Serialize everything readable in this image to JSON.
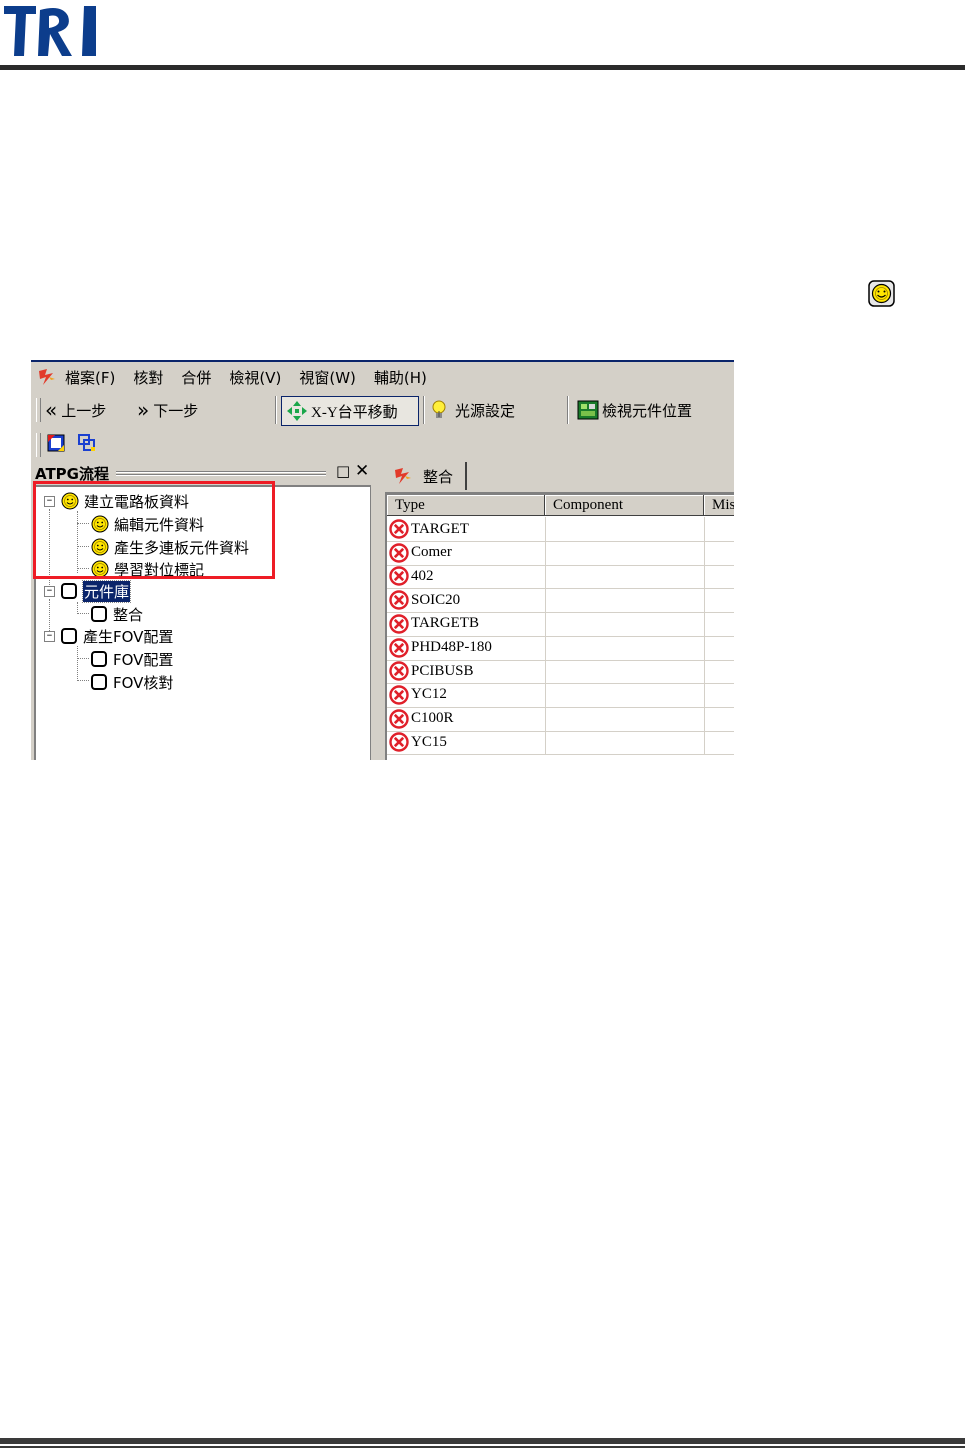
{
  "header": {
    "logo_text": "TRI"
  },
  "menu": {
    "items": [
      "檔案(F)",
      "核對",
      "合併",
      "檢視(V)",
      "視窗(W)",
      "輔助(H)"
    ]
  },
  "toolbar": {
    "prev_label": "上一步",
    "next_label": "下一步",
    "xy_move_label": "X-Y台平移動",
    "light_label": "光源設定",
    "view_pos_label": "檢視元件位置"
  },
  "left_pane": {
    "title": "ATPG流程",
    "tree": [
      {
        "label": "建立電路板資料",
        "status": "done",
        "level": 0,
        "expander": "−"
      },
      {
        "label": "編輯元件資料",
        "status": "done",
        "level": 1
      },
      {
        "label": "產生多連板元件資料",
        "status": "done",
        "level": 1
      },
      {
        "label": "學習對位標記",
        "status": "done",
        "level": 1
      },
      {
        "label": "元件庫",
        "status": "pending",
        "level": 0,
        "expander": "−",
        "selected": true
      },
      {
        "label": "整合",
        "status": "pending",
        "level": 1
      },
      {
        "label": "產生FOV配置",
        "status": "pending",
        "level": 0,
        "expander": "−"
      },
      {
        "label": "FOV配置",
        "status": "pending",
        "level": 1
      },
      {
        "label": "FOV核對",
        "status": "pending",
        "level": 1
      }
    ]
  },
  "right_pane": {
    "tab_label": "整合",
    "columns": [
      "Type",
      "Component",
      "Mis"
    ],
    "rows": [
      "TARGET",
      "Comer",
      "402",
      "SOIC20",
      "TARGETB",
      "PHD48P-180",
      "PCIBUSB",
      "YC12",
      "C100R",
      "YC15"
    ]
  },
  "colors": {
    "highlight_box": "#ee1c25",
    "selection": "#0a246a",
    "error_icon": "#e0202a",
    "smiley": "#ffe600"
  }
}
